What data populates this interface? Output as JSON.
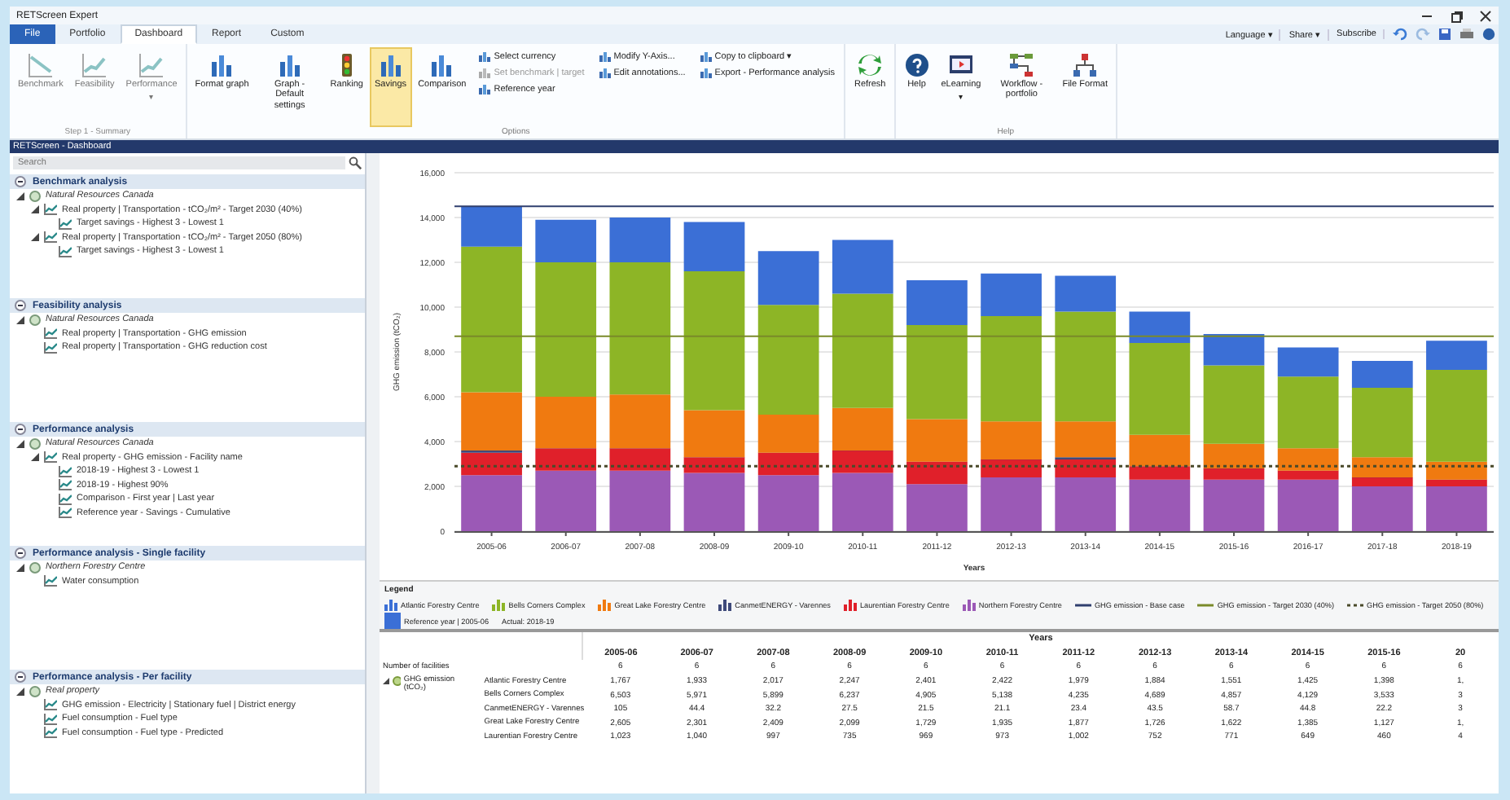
{
  "window": {
    "title": "RETScreen Expert"
  },
  "tabs": [
    {
      "label": "File",
      "selected": false
    },
    {
      "label": "Portfolio",
      "selected": false
    },
    {
      "label": "Dashboard",
      "selected": true
    },
    {
      "label": "Report",
      "selected": false
    },
    {
      "label": "Custom",
      "selected": false
    }
  ],
  "quick_access": [
    "Language ▾",
    "Share ▾",
    "Subscribe"
  ],
  "ribbon": {
    "groups": [
      {
        "label": "Step 1 - Summary",
        "disabled": true,
        "items": [
          {
            "kind": "large",
            "label": "Benchmark",
            "selected": false
          },
          {
            "kind": "large",
            "label": "Feasibility",
            "selected": false
          },
          {
            "kind": "large",
            "label": "Performance",
            "caret": "▾",
            "selected": false
          }
        ]
      },
      {
        "label": "Options",
        "disabled": false,
        "items": [
          {
            "kind": "large",
            "label": "Format graph",
            "selected": false
          },
          {
            "kind": "large",
            "label": "Graph - Default settings",
            "selected": false
          },
          {
            "kind": "large",
            "label": "Ranking",
            "selected": false
          },
          {
            "kind": "large",
            "label": "Savings",
            "selected": true
          },
          {
            "kind": "large",
            "label": "Comparison",
            "selected": false
          },
          {
            "kind": "stack",
            "items": [
              {
                "label": "Select currency",
                "disabled": false
              },
              {
                "label": "Set benchmark | target",
                "disabled": true
              },
              {
                "label": "Reference year",
                "disabled": false
              }
            ]
          },
          {
            "kind": "stack",
            "items": [
              {
                "label": "Modify Y-Axis...",
                "disabled": false
              },
              {
                "label": "Edit annotations...",
                "disabled": false
              }
            ]
          },
          {
            "kind": "stack",
            "items": [
              {
                "label": "Copy to clipboard ▾",
                "disabled": false
              },
              {
                "label": "Export - Performance analysis",
                "disabled": false
              }
            ]
          }
        ]
      },
      {
        "disabled": false,
        "items": [
          {
            "kind": "large",
            "label": "Refresh",
            "selected": false
          }
        ]
      },
      {
        "label": "Help",
        "disabled": false,
        "items": [
          {
            "kind": "large",
            "label": "Help",
            "selected": false
          },
          {
            "kind": "large",
            "label": "eLearning",
            "caret": "▾",
            "selected": false
          },
          {
            "kind": "large",
            "label": "Workflow - portfolio",
            "selected": false
          },
          {
            "kind": "large",
            "label": "File Format",
            "selected": false
          }
        ]
      }
    ]
  },
  "panel_title": "RETScreen - Dashboard",
  "sidebar": {
    "search": {
      "placeholder": "Search"
    },
    "sections": [
      {
        "title": "Benchmark analysis",
        "expanded": true,
        "items": [
          {
            "label": "Natural Resources Canada",
            "expanded": true,
            "children": [
              {
                "label": "Real property | Transportation - tCO₂/m² - Target 2030 (40%)",
                "expanded": true,
                "children": [
                  {
                    "label": "Target savings - Highest 3 - Lowest 1"
                  }
                ]
              },
              {
                "label": "Real property | Transportation - tCO₂/m² - Target 2050 (80%)",
                "expanded": true,
                "children": [
                  {
                    "label": "Target savings - Highest 3 - Lowest 1"
                  }
                ]
              }
            ]
          }
        ]
      },
      {
        "title": "Feasibility analysis",
        "expanded": true,
        "items": [
          {
            "label": "Natural Resources Canada",
            "expanded": true,
            "children": [
              {
                "label": "Real property | Transportation - GHG emission"
              },
              {
                "label": "Real property | Transportation - GHG reduction cost"
              }
            ]
          }
        ]
      },
      {
        "title": "Performance analysis",
        "expanded": true,
        "items": [
          {
            "label": "Natural Resources Canada",
            "expanded": true,
            "children": [
              {
                "label": "Real property - GHG emission - Facility name",
                "expanded": true,
                "children": [
                  {
                    "label": "2018-19 - Highest 3 - Lowest 1"
                  },
                  {
                    "label": "2018-19 - Highest 90%"
                  },
                  {
                    "label": "Comparison - First year | Last year"
                  },
                  {
                    "label": "Reference year - Savings - Cumulative"
                  }
                ]
              }
            ]
          }
        ]
      },
      {
        "title": "Performance analysis - Single facility",
        "expanded": true,
        "items": [
          {
            "label": "Northern Forestry Centre",
            "expanded": true,
            "children": [
              {
                "label": "Water consumption"
              }
            ]
          }
        ]
      },
      {
        "title": "Performance analysis - Per facility",
        "expanded": true,
        "items": [
          {
            "label": "Real property",
            "expanded": true,
            "children": [
              {
                "label": "GHG emission - Electricity | Stationary fuel | District energy"
              },
              {
                "label": "Fuel consumption - Fuel type"
              },
              {
                "label": "Fuel consumption - Fuel type - Predicted"
              }
            ]
          }
        ]
      }
    ]
  },
  "chart_data": {
    "type": "bar",
    "stacked": true,
    "grid": true,
    "xlabel": "Years",
    "ylabel": "GHG emission (tCO₂)",
    "categories": [
      "2005-06",
      "2006-07",
      "2007-08",
      "2008-09",
      "2009-10",
      "2010-11",
      "2011-12",
      "2012-13",
      "2013-14",
      "2014-15",
      "2015-16",
      "2016-17",
      "2017-18",
      "2018-19"
    ],
    "ylim": [
      0,
      16000
    ],
    "yticks": [
      {
        "value": 0,
        "label": "0"
      },
      {
        "value": 2000,
        "label": "2,000"
      },
      {
        "value": 4000,
        "label": "4,000"
      },
      {
        "value": 6000,
        "label": "6,000"
      },
      {
        "value": 8000,
        "label": "8,000"
      },
      {
        "value": 10000,
        "label": "10,000"
      },
      {
        "value": 12000,
        "label": "12,000"
      },
      {
        "value": 14000,
        "label": "14,000"
      },
      {
        "value": 16000,
        "label": "16,000"
      }
    ],
    "series": [
      {
        "name": "Northern Forestry Centre",
        "color": "#9b59b6",
        "values": [
          2500,
          2700,
          2700,
          2600,
          2500,
          2600,
          2100,
          2400,
          2400,
          2300,
          2300,
          2300,
          2000,
          2000
        ]
      },
      {
        "name": "Laurentian Forestry Centre",
        "color": "#e0202a",
        "values": [
          1000,
          1000,
          1000,
          700,
          1000,
          1000,
          1000,
          800,
          800,
          600,
          500,
          400,
          400,
          300
        ]
      },
      {
        "name": "CanmetENERGY - Varennes",
        "color": "#3f4a7a",
        "values": [
          100,
          0,
          0,
          0,
          0,
          0,
          0,
          0,
          100,
          0,
          0,
          0,
          0,
          0
        ]
      },
      {
        "name": "Great Lake Forestry Centre",
        "color": "#f07a10",
        "values": [
          2600,
          2300,
          2400,
          2100,
          1700,
          1900,
          1900,
          1700,
          1600,
          1400,
          1100,
          1000,
          900,
          800
        ]
      },
      {
        "name": "Bells Corners Complex",
        "color": "#8db526",
        "values": [
          6500,
          6000,
          5900,
          6200,
          4900,
          5100,
          4200,
          4700,
          4900,
          4100,
          3500,
          3200,
          3100,
          4100
        ]
      },
      {
        "name": "Atlantic Forestry Centre",
        "color": "#3b6fd6",
        "values": [
          1800,
          1900,
          2000,
          2200,
          2400,
          2400,
          2000,
          1900,
          1600,
          1400,
          1400,
          1300,
          1200,
          1300
        ]
      }
    ],
    "ref_lines": [
      {
        "axis": "y",
        "value": 14500,
        "label": "GHG emission - Base case",
        "color": "#2f3f6e"
      },
      {
        "axis": "y",
        "value": 8700,
        "label": "GHG emission - Target 2030 (40%)",
        "color": "#7a8a2a"
      },
      {
        "axis": "y",
        "value": 2900,
        "label": "GHG emission - Target 2050 (80%)",
        "color": "#4a4a2a"
      }
    ],
    "legend": "bottom"
  },
  "legend": {
    "title": "Legend",
    "items": [
      {
        "kind": "square",
        "label": "Reference year | 2005-06",
        "color": "#3b6fd6"
      },
      {
        "kind": "text",
        "label": "Actual: 2018-19"
      }
    ]
  },
  "table": {
    "header_group": "Years",
    "columns": [
      "2005-06",
      "2006-07",
      "2007-08",
      "2008-09",
      "2009-10",
      "2010-11",
      "2011-12",
      "2012-13",
      "2013-14",
      "2014-15",
      "2015-16",
      "20"
    ],
    "rows": [
      {
        "label": "Number of facilities",
        "values": [
          "6",
          "6",
          "6",
          "6",
          "6",
          "6",
          "6",
          "6",
          "6",
          "6",
          "6",
          "6"
        ]
      }
    ],
    "groups": [
      {
        "label": "GHG emission (tCO₂)",
        "expanded": true,
        "rows": [
          {
            "label": "Atlantic Forestry Centre",
            "values": [
              "1,767",
              "1,933",
              "2,017",
              "2,247",
              "2,401",
              "2,422",
              "1,979",
              "1,884",
              "1,551",
              "1,425",
              "1,398",
              "1,"
            ]
          },
          {
            "label": "Bells Corners Complex",
            "values": [
              "6,503",
              "5,971",
              "5,899",
              "6,237",
              "4,905",
              "5,138",
              "4,235",
              "4,689",
              "4,857",
              "4,129",
              "3,533",
              "3"
            ]
          },
          {
            "label": "CanmetENERGY - Varennes",
            "values": [
              "105",
              "44.4",
              "32.2",
              "27.5",
              "21.5",
              "21.1",
              "23.4",
              "43.5",
              "58.7",
              "44.8",
              "22.2",
              "3"
            ]
          },
          {
            "label": "Great Lake Forestry Centre",
            "values": [
              "2,605",
              "2,301",
              "2,409",
              "2,099",
              "1,729",
              "1,935",
              "1,877",
              "1,726",
              "1,622",
              "1,385",
              "1,127",
              "1,"
            ]
          },
          {
            "label": "Laurentian Forestry Centre",
            "values": [
              "1,023",
              "1,040",
              "997",
              "735",
              "969",
              "973",
              "1,002",
              "752",
              "771",
              "649",
              "460",
              "4"
            ]
          }
        ]
      }
    ]
  }
}
